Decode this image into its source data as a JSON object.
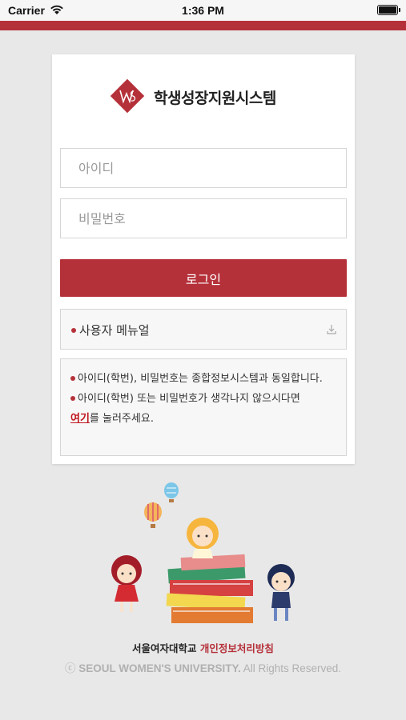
{
  "status_bar": {
    "carrier": "Carrier",
    "time": "1:36 PM"
  },
  "brand": {
    "title": "학생성장지원시스템",
    "logo_icon": "swu-diamond-logo-icon",
    "accent_color": "#b5313a"
  },
  "login_form": {
    "id_placeholder": "아이디",
    "password_placeholder": "비밀번호",
    "login_button": "로그인"
  },
  "manual": {
    "label": "사용자 메뉴얼",
    "icon": "download-icon"
  },
  "notice": {
    "line1": "아이디(학번), 비밀번호는 종합정보시스템과 동일합니다.",
    "line2_prefix": "아이디(학번) 또는 비밀번호가 생각나지 않으시다면",
    "line2_link": "여기",
    "line2_suffix": "를 눌러주세요."
  },
  "footer": {
    "university": "서울여자대학교",
    "privacy_link": "개인정보처리방침",
    "copyright_symbol": "ⓒ",
    "copyright_org": "SEOUL WOMEN'S UNIVERSITY.",
    "copyright_rights": "All Rights Reserved."
  }
}
